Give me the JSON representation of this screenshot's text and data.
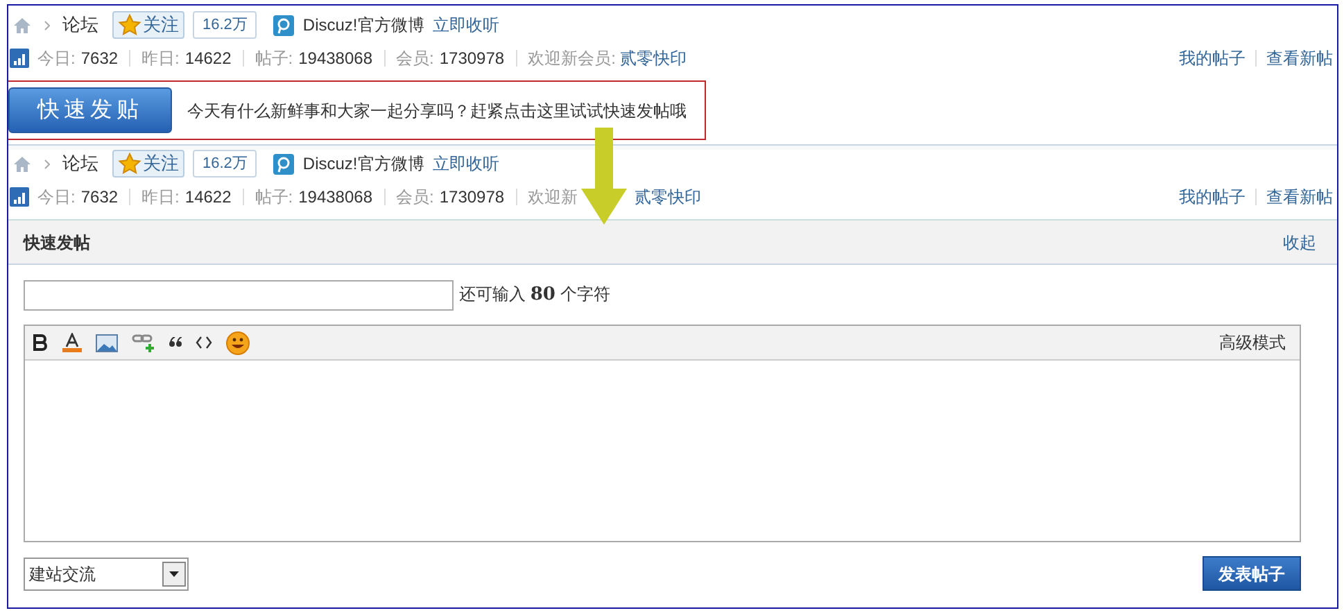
{
  "before": {
    "breadcrumb": {
      "forum": "论坛",
      "follow": "关注",
      "follow_count": "16.2万",
      "weibo": "Discuz!官方微博",
      "listen": "立即收听"
    },
    "stats": [
      {
        "label": "今日:",
        "value": "7632"
      },
      {
        "label": "昨日:",
        "value": "14622"
      },
      {
        "label": "帖子:",
        "value": "19438068"
      },
      {
        "label": "会员:",
        "value": "1730978"
      }
    ],
    "new_member": {
      "label": "欢迎新会员:",
      "name": "贰零快印"
    },
    "links": [
      "我的帖子",
      "查看新帖"
    ],
    "quick_post_bar": {
      "button": "快速发贴",
      "prompt": "今天有什么新鲜事和大家一起分享吗？赶紧点击这里试试快速发帖哦"
    }
  },
  "after": {
    "breadcrumb": {
      "forum": "论坛",
      "follow": "关注",
      "follow_count": "16.2万",
      "weibo": "Discuz!官方微博",
      "listen": "立即收听"
    },
    "stats": [
      {
        "label": "今日:",
        "value": "7632"
      },
      {
        "label": "昨日:",
        "value": "14622"
      },
      {
        "label": "帖子:",
        "value": "19438068"
      },
      {
        "label": "会员:",
        "value": "1730978"
      }
    ],
    "new_member": {
      "label": "欢迎新",
      "name": "贰零快印"
    },
    "links": [
      "我的帖子",
      "查看新帖"
    ],
    "quick_post_form": {
      "title": "快速发帖",
      "collapse": "收起",
      "counter_prefix": "还可输入",
      "counter_value": "80",
      "counter_suffix": "个字符",
      "advanced": "高级模式",
      "category": "建站交流",
      "submit": "发表帖子"
    }
  }
}
